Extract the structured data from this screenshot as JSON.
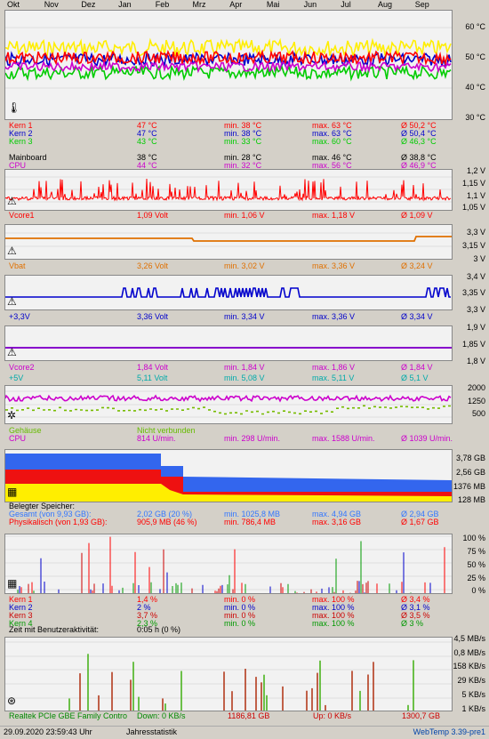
{
  "months": [
    "Okt",
    "Nov",
    "Dez",
    "Jan",
    "Feb",
    "Mrz",
    "Apr",
    "Mai",
    "Jun",
    "Jul",
    "Aug",
    "Sep"
  ],
  "temp": {
    "axis": [
      "60 °C",
      "50 °C",
      "40 °C",
      "30 °C"
    ],
    "rows": [
      {
        "name": "Kern 1",
        "cur": "47 °C",
        "min": "min. 38 °C",
        "max": "max. 63 °C",
        "avg": "Ø 50,2 °C",
        "color": "#ff0000"
      },
      {
        "name": "Kern 2",
        "cur": "47 °C",
        "min": "min. 38 °C",
        "max": "max. 63 °C",
        "avg": "Ø 50,4 °C",
        "color": "#0000cc"
      },
      {
        "name": "Kern 3",
        "cur": "43 °C",
        "min": "min. 33 °C",
        "max": "max. 60 °C",
        "avg": "Ø 46,3 °C",
        "color": "#00cc00"
      },
      {
        "name": "Mainboard",
        "cur": "38 °C",
        "min": "min. 28 °C",
        "max": "max. 46 °C",
        "avg": "Ø 38,8 °C",
        "color": "#000000"
      },
      {
        "name": "CPU",
        "cur": "44 °C",
        "min": "min. 32 °C",
        "max": "max. 56 °C",
        "avg": "Ø 46,9 °C",
        "color": "#cc00cc"
      }
    ]
  },
  "vcore1": {
    "axis": [
      "1,2 V",
      "1,15 V",
      "1,1 V",
      "1,05 V"
    ],
    "row": {
      "name": "Vcore1",
      "cur": "1,09 Volt",
      "min": "min. 1,06 V",
      "max": "max. 1,18 V",
      "avg": "Ø 1,09 V",
      "color": "#ff0000"
    }
  },
  "vbat": {
    "axis": [
      "3,3 V",
      "3,15 V",
      "3 V"
    ],
    "row": {
      "name": "Vbat",
      "cur": "3,26 Volt",
      "min": "min. 3,02 V",
      "max": "max. 3,36 V",
      "avg": "Ø 3,24 V",
      "color": "#e07000"
    }
  },
  "v33": {
    "axis": [
      "3,4 V",
      "3,35 V",
      "3,3 V"
    ],
    "row": {
      "name": "+3,3V",
      "cur": "3,36 Volt",
      "min": "min. 3,34 V",
      "max": "max. 3,36 V",
      "avg": "Ø 3,34 V",
      "color": "#0000cc"
    }
  },
  "vcore2": {
    "axis": [
      "1,9 V",
      "1,85 V",
      "1,8 V"
    ],
    "rows": [
      {
        "name": "Vcore2",
        "cur": "1,84 Volt",
        "min": "min. 1,84 V",
        "max": "max. 1,86 V",
        "avg": "Ø 1,84 V",
        "color": "#cc00cc"
      },
      {
        "name": "+5V",
        "cur": "5,11 Volt",
        "min": "min. 5,08 V",
        "max": "max. 5,11 V",
        "avg": "Ø 5,1 V",
        "color": "#00aaaa"
      }
    ]
  },
  "fan": {
    "axis": [
      "2000",
      "1250",
      "500"
    ],
    "rows": [
      {
        "name": "Gehäuse",
        "cur": "Nicht verbunden",
        "min": "",
        "max": "",
        "avg": "",
        "color": "#66bb00"
      },
      {
        "name": "CPU",
        "cur": "814 U/min.",
        "min": "min. 298 U/min.",
        "max": "max. 1588 U/min.",
        "avg": "Ø 1039 U/min.",
        "color": "#cc00cc"
      }
    ]
  },
  "mem": {
    "axis": [
      "3,78 GB",
      "2,56 GB",
      "1376 MB",
      "128 MB"
    ],
    "title": "Belegter Speicher:",
    "rows": [
      {
        "name": "Gesamt (von 9,93 GB):",
        "cur": "2,02 GB (20 %)",
        "min": "min. 1025,8 MB",
        "max": "max. 4,94 GB",
        "avg": "Ø 2,94 GB",
        "color": "#3377ff"
      },
      {
        "name": "Physikalisch (von 1,93 GB):",
        "cur": "905,9 MB (46 %)",
        "min": "min. 786,4 MB",
        "max": "max. 3,16 GB",
        "avg": "Ø 1,67 GB",
        "color": "#ff0000"
      }
    ]
  },
  "cpuload": {
    "axis": [
      "100 %",
      "75 %",
      "50 %",
      "25 %",
      "0 %"
    ],
    "rows": [
      {
        "name": "Kern 1",
        "cur": "1,4 %",
        "min": "min. 0 %",
        "max": "max. 100 %",
        "avg": "Ø 3,4 %",
        "color": "#ff0000"
      },
      {
        "name": "Kern 2",
        "cur": "2 %",
        "min": "min. 0 %",
        "max": "max. 100 %",
        "avg": "Ø 3,1 %",
        "color": "#0000cc"
      },
      {
        "name": "Kern 3",
        "cur": "3,7 %",
        "min": "min. 0 %",
        "max": "max. 100 %",
        "avg": "Ø 3,5 %",
        "color": "#cc0000"
      },
      {
        "name": "Kern 4",
        "cur": "2,3 %",
        "min": "min. 0 %",
        "max": "max. 100 %",
        "avg": "Ø 3 %",
        "color": "#009900"
      }
    ],
    "activity": {
      "label": "Zeit mit Benutzeraktivität:",
      "value": "0:05 h (0 %)"
    }
  },
  "net": {
    "axis": [
      "4,5 MB/s",
      "0,8 MB/s",
      "158 KB/s",
      "29 KB/s",
      "5 KB/s",
      "1 KB/s"
    ],
    "adapter": "Realtek PCIe GBE Family Contro",
    "down": "Down: 0 KB/s",
    "down_total": "1186,81 GB",
    "up": "Up: 0 KB/s",
    "up_total": "1300,7 GB"
  },
  "footer": {
    "datetime": "29.09.2020 23:59:43 Uhr",
    "mode": "Jahresstatistik",
    "version": "WebTemp 3.39-pre1"
  }
}
